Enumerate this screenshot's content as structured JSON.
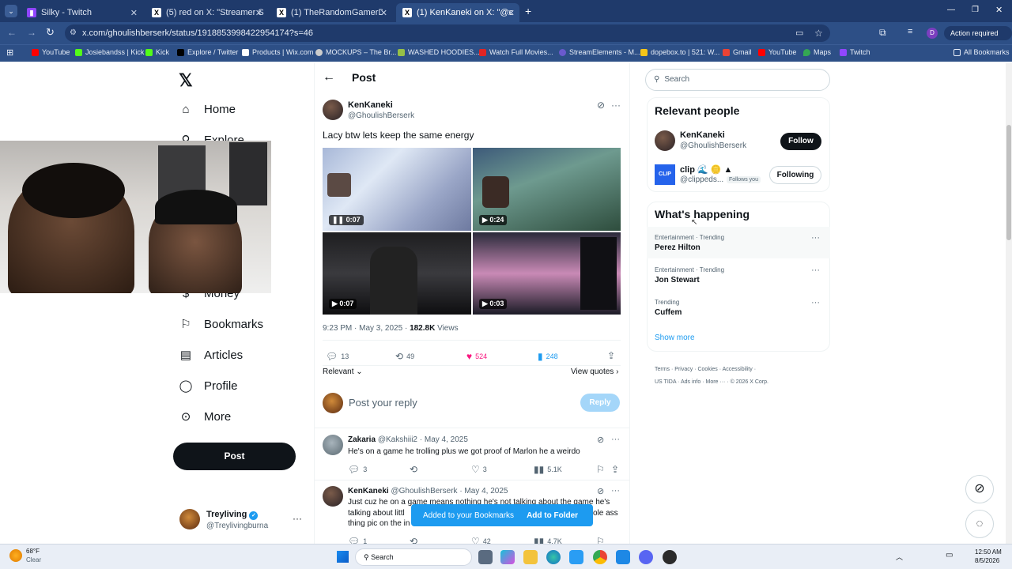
{
  "tabs": [
    {
      "label": "Silky - Twitch",
      "icon": "twitch-icon"
    },
    {
      "label": "(5) red on X: \"Streamer Silky eg",
      "icon": "x-logo-icon"
    },
    {
      "label": "(1) TheRandomGamerDude on",
      "icon": "x-logo-icon"
    },
    {
      "label": "(1) KenKaneki on X: \"@clipped",
      "icon": "x-logo-icon"
    }
  ],
  "address": {
    "url": "x.com/ghoulishberserk/status/1918853998422954174?s=46",
    "action_required": "Action required",
    "profile_initial": "D"
  },
  "bookmarks": {
    "items": [
      "YouTube",
      "Josiebandss | Kick",
      "Kick",
      "Explore / Twitter",
      "Products | Wix.com",
      "MOCKUPS – The Br...",
      "WASHED HOODIES...",
      "Watch Full Movies...",
      "StreamElements - M...",
      "dopebox.to | 521: W...",
      "Gmail",
      "YouTube",
      "Maps",
      "Twitch"
    ],
    "all": "All Bookmarks"
  },
  "nav": {
    "items": [
      "Home",
      "Explore",
      "Money",
      "Bookmarks",
      "Articles",
      "Profile",
      "More"
    ],
    "post_button": "Post",
    "account_name": "Treyliving",
    "account_handle": "@Treylivingburna"
  },
  "post": {
    "header": "Post",
    "author_name": "KenKaneki",
    "author_handle": "@GhoulishBerserk",
    "text": "Lacy btw lets keep the same energy",
    "video_durations": [
      "0:07",
      "0:24",
      "0:07",
      "0:03"
    ],
    "time": "9:23 PM · May 3, 2025 · ",
    "views": "182.8K",
    "views_label": " Views",
    "replies": "13",
    "reposts": "49",
    "likes": "524",
    "bookmarks": "248",
    "sort": "Relevant",
    "view_quotes": "View quotes"
  },
  "composer": {
    "placeholder": "Post your reply",
    "button": "Reply"
  },
  "replies": [
    {
      "name": "Zakaria",
      "meta": "@Kakshiii2 · May 4, 2025",
      "text": "He's on a game he trolling plus we got proof of Marlon he a weirdo",
      "replies": "3",
      "reposts": "",
      "likes": "3",
      "views": "5.1K"
    },
    {
      "name": "KenKaneki",
      "meta": "@GhoulishBerserk · May 4, 2025",
      "line1": "Just cuz he on a game means nothing he's not talking about the game he's",
      "line2a": "talking about littl",
      "line2b": "ole ass",
      "line3a": "thing pic on the in",
      "replies": "1",
      "likes": "42",
      "views": "4.7K"
    }
  ],
  "toast": {
    "message": "Added to your Bookmarks",
    "action": "Add to Folder"
  },
  "sidebar": {
    "search_placeholder": "Search",
    "relevant_title": "Relevant people",
    "people": [
      {
        "name": "KenKaneki",
        "handle": "@GhoulishBerserk",
        "button": "Follow",
        "follows_you": ""
      },
      {
        "name": "clip 🌊 🪙 ▲",
        "handle": "@clippeds...",
        "button": "Following",
        "follows_you": "Follows you"
      }
    ],
    "happening_title": "What's happening",
    "trends": [
      {
        "context": "Entertainment · Trending",
        "name": "Perez Hilton"
      },
      {
        "context": "Entertainment · Trending",
        "name": "Jon Stewart"
      },
      {
        "context": "Trending",
        "name": "Cuffem"
      }
    ],
    "show_more": "Show more",
    "footer": [
      "Terms",
      "Privacy",
      "Cookies",
      "Accessibility",
      "US TIDA",
      "Ads info",
      "More ···",
      "© 2026 X Corp."
    ]
  },
  "taskbar": {
    "weather_temp": "68°F",
    "weather_desc": "Clear",
    "search": "Search",
    "time": "12:50 AM",
    "date": "8/5/2026"
  },
  "colors": {
    "tab_bg": "#1f3a6b",
    "toast": "#1d9bf0",
    "like": "#f91880",
    "bookmark": "#1d9bf0",
    "verified": "#1d9bf0"
  }
}
